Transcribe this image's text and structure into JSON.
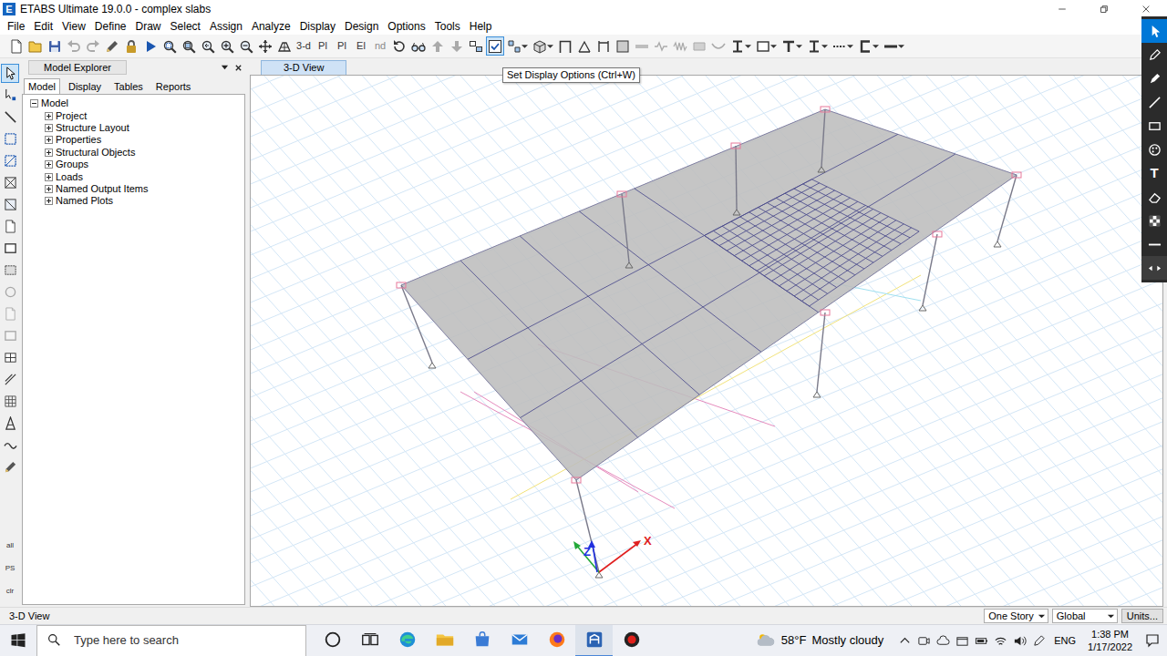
{
  "window": {
    "title": "ETABS Ultimate 19.0.0 - complex slabs",
    "app_icon": "E"
  },
  "menu": [
    "File",
    "Edit",
    "View",
    "Define",
    "Draw",
    "Select",
    "Assign",
    "Analyze",
    "Display",
    "Design",
    "Options",
    "Tools",
    "Help"
  ],
  "toolbar": {
    "buttons": [
      {
        "kind": "new",
        "disabled": false,
        "selected": false
      },
      {
        "kind": "open",
        "disabled": false,
        "selected": false
      },
      {
        "kind": "save",
        "disabled": false,
        "selected": false
      },
      {
        "kind": "undo",
        "disabled": true,
        "selected": false
      },
      {
        "kind": "redo",
        "disabled": true,
        "selected": false
      },
      {
        "kind": "pencil",
        "disabled": false,
        "selected": false
      },
      {
        "kind": "lock",
        "disabled": false,
        "selected": false
      },
      {
        "kind": "run",
        "disabled": false,
        "selected": false
      },
      {
        "kind": "zoomwin",
        "disabled": false,
        "selected": false
      },
      {
        "kind": "zoomfull",
        "disabled": false,
        "selected": false
      },
      {
        "kind": "zoomprev",
        "disabled": false,
        "selected": false
      },
      {
        "kind": "zoomin",
        "disabled": false,
        "selected": false
      },
      {
        "kind": "zoomout",
        "disabled": false,
        "selected": false
      },
      {
        "kind": "pan",
        "disabled": false,
        "selected": false
      },
      {
        "kind": "perspective",
        "disabled": false,
        "selected": false
      },
      {
        "kind": "label",
        "label": "3-d",
        "disabled": false,
        "selected": false
      },
      {
        "kind": "label",
        "label": "Pl",
        "disabled": false,
        "selected": false
      },
      {
        "kind": "label",
        "label": "Pl",
        "disabled": false,
        "selected": false
      },
      {
        "kind": "label",
        "label": "El",
        "disabled": false,
        "selected": false
      },
      {
        "kind": "label",
        "label": "nd",
        "disabled": true,
        "selected": false
      },
      {
        "kind": "rotate",
        "disabled": false,
        "selected": false
      },
      {
        "kind": "glasses",
        "disabled": false,
        "selected": false
      },
      {
        "kind": "up",
        "disabled": true,
        "selected": false
      },
      {
        "kind": "down",
        "disabled": true,
        "selected": false
      },
      {
        "kind": "objects",
        "disabled": false,
        "selected": false
      },
      {
        "kind": "display",
        "disabled": false,
        "selected": true
      },
      {
        "kind": "shrink",
        "disabled": false,
        "selected": false
      },
      {
        "kind": "box3d",
        "disabled": false,
        "selected": false
      },
      {
        "kind": "frame",
        "disabled": false,
        "selected": false
      },
      {
        "kind": "brace",
        "disabled": false,
        "selected": false
      },
      {
        "kind": "column",
        "disabled": false,
        "selected": false
      },
      {
        "kind": "wall",
        "disabled": false,
        "selected": false
      },
      {
        "kind": "beam",
        "disabled": true,
        "selected": false
      },
      {
        "kind": "link",
        "disabled": true,
        "selected": false
      },
      {
        "kind": "spring",
        "disabled": true,
        "selected": false
      },
      {
        "kind": "area",
        "disabled": true,
        "selected": false
      },
      {
        "kind": "tendon",
        "disabled": true,
        "selected": false
      },
      {
        "kind": "ibeam",
        "disabled": false,
        "selected": false
      },
      {
        "kind": "panel",
        "disabled": false,
        "selected": false
      },
      {
        "kind": "tbeam",
        "disabled": false,
        "selected": false
      },
      {
        "kind": "ibeam",
        "disabled": false,
        "selected": false
      },
      {
        "kind": "dashline",
        "disabled": false,
        "selected": false
      },
      {
        "kind": "channel",
        "disabled": false,
        "selected": false
      },
      {
        "kind": "line",
        "disabled": false,
        "selected": false
      }
    ],
    "tooltip": "Set Display Options (Ctrl+W)"
  },
  "left_toolbar": {
    "buttons": [
      {
        "kind": "pointer",
        "selected": true,
        "disabled": false
      },
      {
        "kind": "reshape",
        "selected": false,
        "disabled": false
      },
      {
        "kind": "diag",
        "selected": false,
        "disabled": false
      },
      {
        "kind": "dashedrect",
        "selected": false,
        "disabled": false
      },
      {
        "kind": "dashedrect2",
        "selected": false,
        "disabled": false
      },
      {
        "kind": "xbox",
        "selected": false,
        "disabled": false
      },
      {
        "kind": "xbox2",
        "selected": false,
        "disabled": false
      },
      {
        "kind": "new",
        "selected": false,
        "disabled": false
      },
      {
        "kind": "panel",
        "selected": false,
        "disabled": false
      },
      {
        "kind": "dashedpanel",
        "selected": false,
        "disabled": false
      },
      {
        "kind": "circle",
        "selected": false,
        "disabled": true
      },
      {
        "kind": "new",
        "selected": false,
        "disabled": true
      },
      {
        "kind": "panel",
        "selected": false,
        "disabled": true
      },
      {
        "kind": "panel2",
        "selected": false,
        "disabled": false
      },
      {
        "kind": "diag2",
        "selected": false,
        "disabled": false
      },
      {
        "kind": "grid",
        "selected": false,
        "disabled": false
      },
      {
        "kind": "tower",
        "selected": false,
        "disabled": false
      },
      {
        "kind": "wave",
        "selected": false,
        "disabled": false
      },
      {
        "kind": "pencil",
        "selected": false,
        "disabled": false
      }
    ],
    "labels": [
      "all",
      "PS",
      "clr"
    ]
  },
  "ink_toolbar": {
    "tools": [
      {
        "kind": "select",
        "selected": true
      },
      {
        "kind": "pen",
        "selected": false
      },
      {
        "kind": "highlighter",
        "selected": false
      },
      {
        "kind": "ruler",
        "selected": false
      },
      {
        "kind": "rectangle",
        "selected": false
      },
      {
        "kind": "palette",
        "selected": false
      },
      {
        "kind": "text",
        "glyph": "T",
        "selected": false
      },
      {
        "kind": "eraser",
        "selected": false
      },
      {
        "kind": "checker",
        "selected": false
      },
      {
        "kind": "line",
        "selected": false
      },
      {
        "kind": "expand",
        "selected": false
      }
    ]
  },
  "explorer": {
    "title": "Model Explorer",
    "tabs": [
      {
        "label": "Model",
        "selected": true
      },
      {
        "label": "Display",
        "selected": false
      },
      {
        "label": "Tables",
        "selected": false
      },
      {
        "label": "Reports",
        "selected": false
      }
    ],
    "tree": {
      "label": "Model",
      "expanded": true,
      "children": [
        {
          "label": "Project",
          "expanded": false
        },
        {
          "label": "Structure Layout",
          "expanded": false
        },
        {
          "label": "Properties",
          "expanded": false
        },
        {
          "label": "Structural Objects",
          "expanded": false
        },
        {
          "label": "Groups",
          "expanded": false
        },
        {
          "label": "Loads",
          "expanded": false
        },
        {
          "label": "Named Output Items",
          "expanded": false
        },
        {
          "label": "Named Plots",
          "expanded": false
        }
      ]
    }
  },
  "view": {
    "tab": {
      "label": "3-D View",
      "selected": true
    },
    "axes": {
      "x": "X",
      "z": "Z"
    }
  },
  "status_bar": {
    "text": "3-D View",
    "story": "One Story",
    "coord": "Global",
    "units": "Units..."
  },
  "taskbar": {
    "search_placeholder": "Type here to search",
    "apps": [
      {
        "kind": "cortana",
        "active": false
      },
      {
        "kind": "taskview",
        "active": false
      },
      {
        "kind": "edge",
        "active": false
      },
      {
        "kind": "explorer",
        "active": false
      },
      {
        "kind": "store",
        "active": false
      },
      {
        "kind": "mail",
        "active": false
      },
      {
        "kind": "firefox",
        "active": false
      },
      {
        "kind": "etabs",
        "active": true
      },
      {
        "kind": "record",
        "active": false
      }
    ],
    "weather": {
      "temp": "58°F",
      "text": "Mostly cloudy"
    },
    "language": "ENG",
    "time": "1:38 PM",
    "date": "1/17/2022"
  }
}
